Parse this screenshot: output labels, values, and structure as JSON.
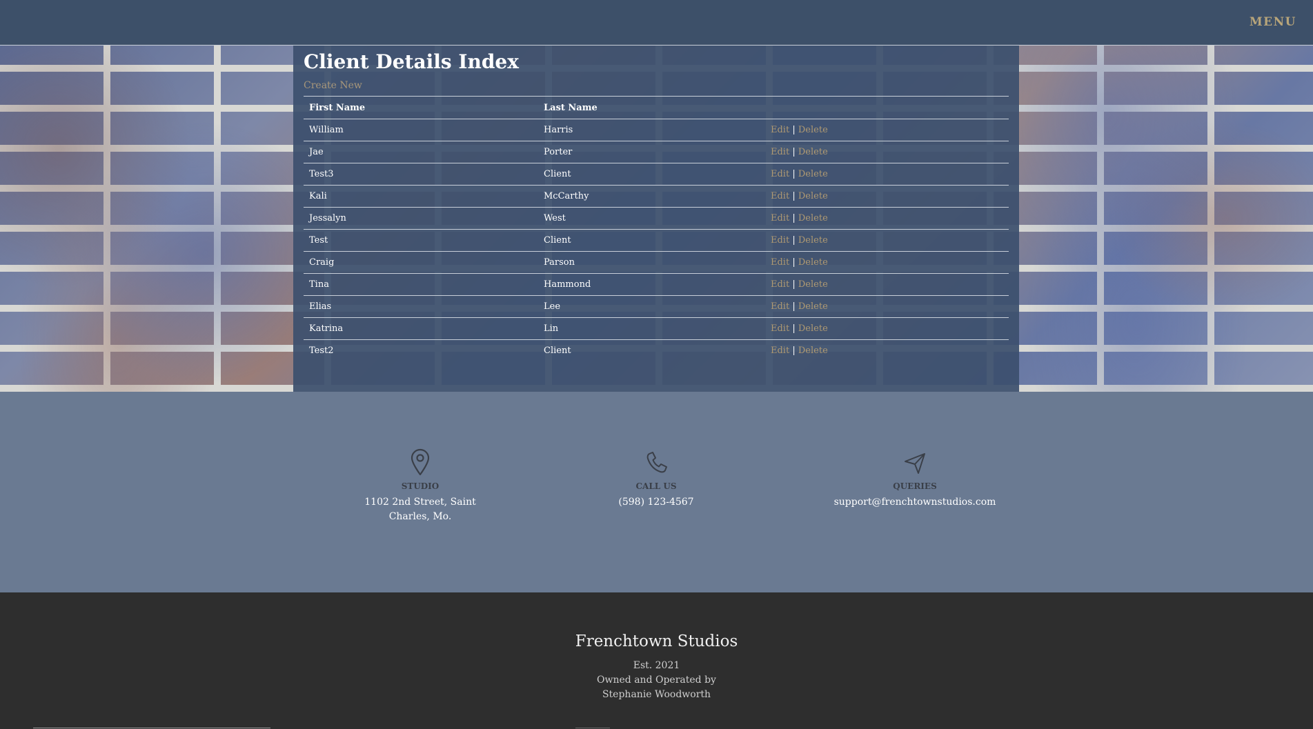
{
  "header": {
    "menu_label": "MENU"
  },
  "main": {
    "title": "Client Details Index",
    "create_new_label": "Create New",
    "table": {
      "columns": [
        "First Name",
        "Last Name",
        ""
      ],
      "edit_label": "Edit",
      "separator": "|",
      "delete_label": "Delete",
      "rows": [
        {
          "first": "William",
          "last": "Harris"
        },
        {
          "first": "Jae",
          "last": "Porter"
        },
        {
          "first": "Test3",
          "last": "Client"
        },
        {
          "first": "Kali",
          "last": "McCarthy"
        },
        {
          "first": "Jessalyn",
          "last": "West"
        },
        {
          "first": "Test",
          "last": "Client"
        },
        {
          "first": "Craig",
          "last": "Parson"
        },
        {
          "first": "Tina",
          "last": "Hammond"
        },
        {
          "first": "Elias",
          "last": "Lee"
        },
        {
          "first": "Katrina",
          "last": "Lin"
        },
        {
          "first": "Test2",
          "last": "Client"
        }
      ]
    }
  },
  "contact": {
    "studio": {
      "icon": "map-pin-icon",
      "label": "STUDIO",
      "line1": "1102 2nd Street, Saint",
      "line2": "Charles, Mo."
    },
    "call": {
      "icon": "phone-icon",
      "label": "CALL US",
      "value": "(598) 123-4567"
    },
    "queries": {
      "icon": "paper-plane-icon",
      "label": "QUERIES",
      "value": "support@frenchtownstudios.com"
    }
  },
  "footer": {
    "brand": "Frenchtown Studios",
    "established": "Est. 2021",
    "owned_line1": "Owned and Operated by",
    "owned_line2": "Stephanie Woodworth"
  },
  "colors": {
    "header_bg": "#3d5069",
    "panel_bg": "#3c506e",
    "link_gold": "#b09a72",
    "contact_bg": "#6a7a92",
    "footer_bg": "#2e2e2e"
  }
}
